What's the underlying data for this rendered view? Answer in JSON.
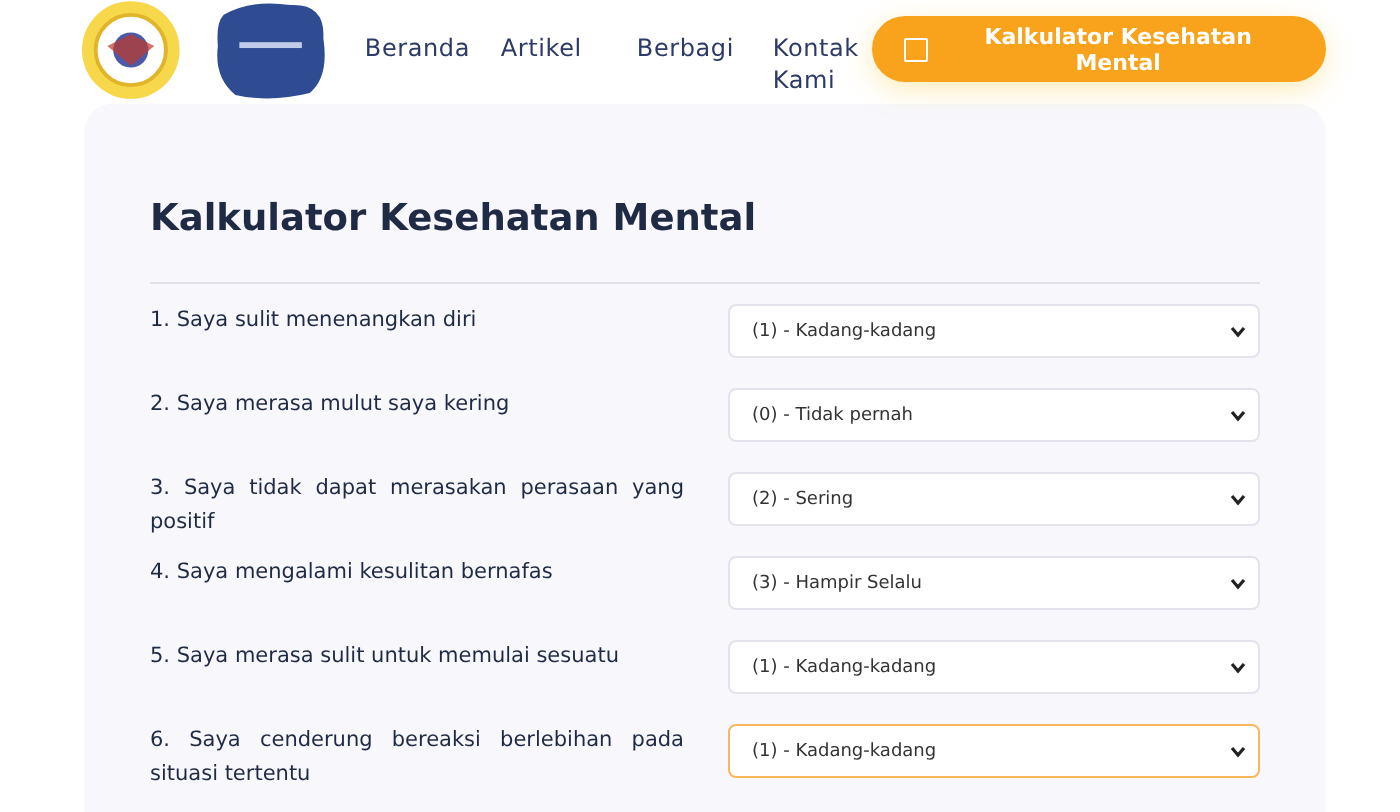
{
  "nav": {
    "links": [
      {
        "label": "Beranda"
      },
      {
        "label": "Artikel"
      },
      {
        "label": "Berbagi"
      },
      {
        "label": "Kontak Kami"
      }
    ],
    "cta": {
      "label": "Kalkulator Kesehatan Mental"
    }
  },
  "card": {
    "title": "Kalkulator Kesehatan Mental",
    "questions": [
      {
        "label": "1. Saya sulit menenangkan diri",
        "value": "(1) - Kadang-kadang",
        "focused": false
      },
      {
        "label": "2. Saya merasa mulut saya kering",
        "value": "(0) - Tidak pernah",
        "focused": false
      },
      {
        "label": "3. Saya tidak dapat merasakan perasaan yang positif",
        "value": "(2) - Sering",
        "focused": false
      },
      {
        "label": "4. Saya mengalami kesulitan bernafas",
        "value": "(3) - Hampir Selalu",
        "focused": false
      },
      {
        "label": "5. Saya merasa sulit untuk memulai sesuatu",
        "value": "(1) - Kadang-kadang",
        "focused": false
      },
      {
        "label": "6. Saya cenderung bereaksi berlebihan pada situasi tertentu",
        "value": "(1) - Kadang-kadang",
        "focused": true
      }
    ]
  }
}
